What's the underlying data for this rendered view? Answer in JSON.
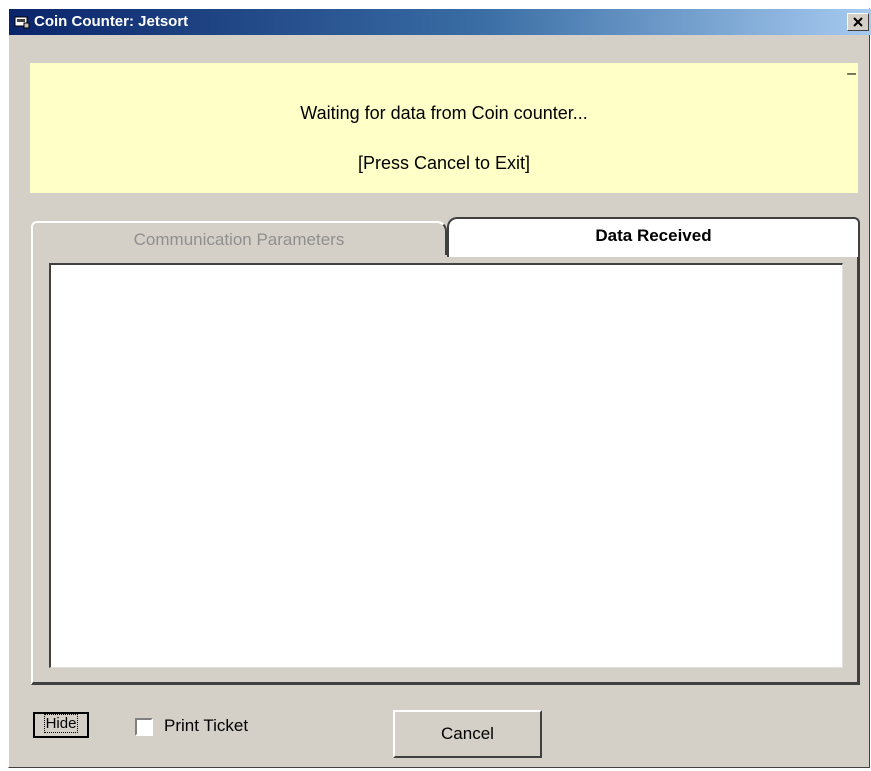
{
  "window": {
    "title": "Coin Counter: Jetsort",
    "icon": "app-icon",
    "close_icon": "close-icon"
  },
  "status": {
    "line1": "Waiting for data from Coin counter...",
    "line2": "[Press Cancel to Exit]",
    "minimize_mark": "–",
    "background": "#ffffc8"
  },
  "tabs": [
    {
      "label": "Communication Parameters",
      "active": false
    },
    {
      "label": "Data Received",
      "active": true
    }
  ],
  "data_received": {
    "content": ""
  },
  "footer": {
    "hide_label": "Hide",
    "print_ticket_label": "Print Ticket",
    "print_ticket_checked": false,
    "cancel_label": "Cancel"
  },
  "colors": {
    "titlebar_start": "#0a246a",
    "titlebar_end": "#a6caf0",
    "face": "#d4d0c8"
  }
}
